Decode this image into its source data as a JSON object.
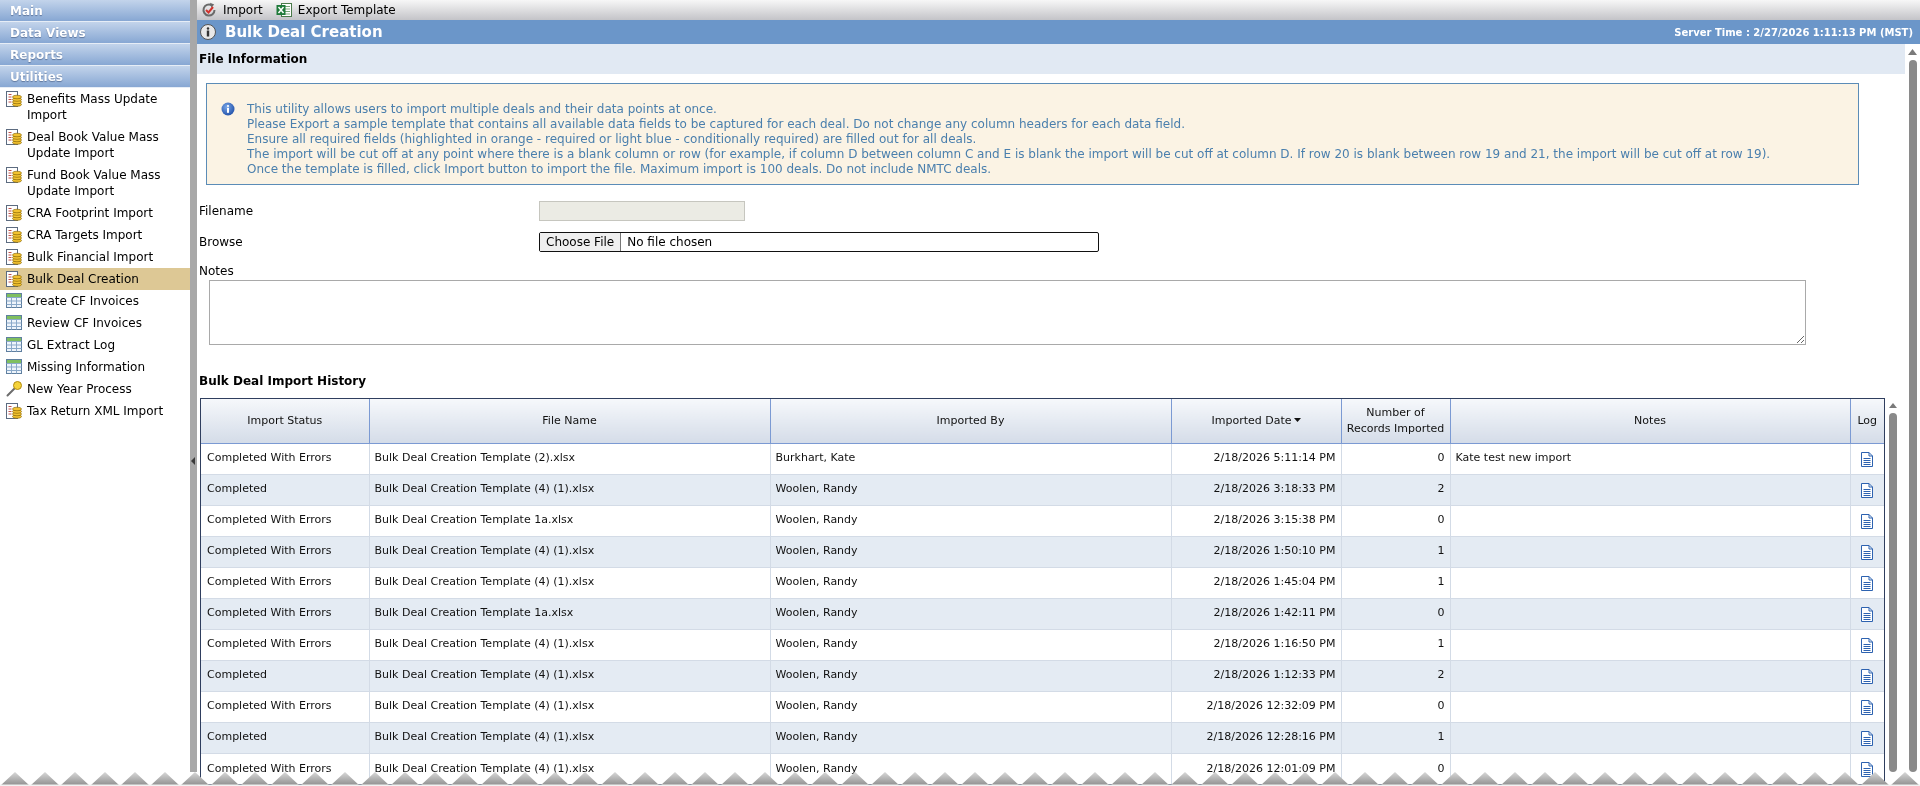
{
  "toolbar": {
    "buttons": [
      {
        "kind": "import",
        "label": "Import"
      },
      {
        "kind": "export",
        "label": "Export Template"
      }
    ]
  },
  "sidebar": {
    "sections": [
      {
        "label": "Main"
      },
      {
        "label": "Data Views"
      },
      {
        "label": "Reports"
      },
      {
        "label": "Utilities",
        "items": [
          {
            "label": "Benefits Mass Update Import",
            "kind": "report",
            "selected": false
          },
          {
            "label": "Deal Book Value Mass Update Import",
            "kind": "report",
            "selected": false
          },
          {
            "label": "Fund Book Value Mass Update Import",
            "kind": "report",
            "selected": false
          },
          {
            "label": "CRA Footprint Import",
            "kind": "report",
            "selected": false
          },
          {
            "label": "CRA Targets Import",
            "kind": "report",
            "selected": false
          },
          {
            "label": "Bulk Financial Import",
            "kind": "report",
            "selected": false
          },
          {
            "label": "Bulk Deal Creation",
            "kind": "report",
            "selected": true
          },
          {
            "label": "Create CF Invoices",
            "kind": "grid",
            "selected": false
          },
          {
            "label": "Review CF Invoices",
            "kind": "grid",
            "selected": false
          },
          {
            "label": "GL Extract Log",
            "kind": "grid",
            "selected": false
          },
          {
            "label": "Missing Information",
            "kind": "grid",
            "selected": false
          },
          {
            "label": "New Year Process",
            "kind": "wand",
            "selected": false
          },
          {
            "label": "Tax Return XML Import",
            "kind": "report",
            "selected": false
          }
        ]
      }
    ]
  },
  "header": {
    "title": "Bulk Deal Creation",
    "server_time": "Server Time : 2/27/2026 1:11:13 PM (MST)"
  },
  "file_information": {
    "heading": "File Information",
    "notice": [
      "This utility allows users to import multiple deals and their data points at once.",
      "Please Export a sample template that contains all available data fields to be captured for each deal. Do not change any column headers for each data field.",
      "Ensure all required fields (highlighted in orange - required or light blue - conditionally required) are filled out for all deals.",
      "The import will be cut off at any point where there is a blank column or row (for example, if column D between column C and E is blank the import will be cut off at column D. If row 20 is blank between row 19 and 21, the import will be cut off at row 19).",
      "Once the template is filled, click Import button to import the file. Maximum import is 100 deals. Do not include NMTC deals."
    ],
    "filename": {
      "label": "Filename",
      "disabled": true
    },
    "browse": {
      "label": "Browse",
      "button": "Choose File",
      "value": "No file chosen"
    },
    "notes": {
      "label": "Notes"
    }
  },
  "import_history": {
    "heading": "Bulk Deal Import History",
    "columns": [
      {
        "label": "Import Status",
        "sorted": false
      },
      {
        "label": "File Name",
        "sorted": false
      },
      {
        "label": "Imported By",
        "sorted": false
      },
      {
        "label": "Imported Date",
        "sorted": true
      },
      {
        "label": "Number of Records Imported",
        "sorted": false
      },
      {
        "label": "Notes",
        "sorted": false
      },
      {
        "label": "Log",
        "sorted": false
      }
    ],
    "rows": [
      {
        "import_status": "Completed With Errors",
        "file_name": "Bulk Deal Creation Template (2).xlsx",
        "imported_by": "Burkhart, Kate",
        "imported_date": "2/18/2026 5:11:14 PM",
        "records_imported": "0",
        "notes": "Kate test new import"
      },
      {
        "import_status": "Completed",
        "file_name": "Bulk Deal Creation Template (4) (1).xlsx",
        "imported_by": "Woolen, Randy",
        "imported_date": "2/18/2026 3:18:33 PM",
        "records_imported": "2"
      },
      {
        "import_status": "Completed With Errors",
        "file_name": "Bulk Deal Creation Template 1a.xlsx",
        "imported_by": "Woolen, Randy",
        "imported_date": "2/18/2026 3:15:38 PM",
        "records_imported": "0"
      },
      {
        "import_status": "Completed With Errors",
        "file_name": "Bulk Deal Creation Template (4) (1).xlsx",
        "imported_by": "Woolen, Randy",
        "imported_date": "2/18/2026 1:50:10 PM",
        "records_imported": "1"
      },
      {
        "import_status": "Completed With Errors",
        "file_name": "Bulk Deal Creation Template (4) (1).xlsx",
        "imported_by": "Woolen, Randy",
        "imported_date": "2/18/2026 1:45:04 PM",
        "records_imported": "1"
      },
      {
        "import_status": "Completed With Errors",
        "file_name": "Bulk Deal Creation Template 1a.xlsx",
        "imported_by": "Woolen, Randy",
        "imported_date": "2/18/2026 1:42:11 PM",
        "records_imported": "0"
      },
      {
        "import_status": "Completed With Errors",
        "file_name": "Bulk Deal Creation Template (4) (1).xlsx",
        "imported_by": "Woolen, Randy",
        "imported_date": "2/18/2026 1:16:50 PM",
        "records_imported": "1"
      },
      {
        "import_status": "Completed",
        "file_name": "Bulk Deal Creation Template (4) (1).xlsx",
        "imported_by": "Woolen, Randy",
        "imported_date": "2/18/2026 1:12:33 PM",
        "records_imported": "2"
      },
      {
        "import_status": "Completed With Errors",
        "file_name": "Bulk Deal Creation Template (4) (1).xlsx",
        "imported_by": "Woolen, Randy",
        "imported_date": "2/18/2026 12:32:09 PM",
        "records_imported": "0"
      },
      {
        "import_status": "Completed",
        "file_name": "Bulk Deal Creation Template (4) (1).xlsx",
        "imported_by": "Woolen, Randy",
        "imported_date": "2/18/2026 12:28:16 PM",
        "records_imported": "1"
      },
      {
        "import_status": "Completed With Errors",
        "file_name": "Bulk Deal Creation Template (4) (1).xlsx",
        "imported_by": "Woolen, Randy",
        "imported_date": "2/18/2026 12:01:09 PM",
        "records_imported": "0"
      }
    ]
  }
}
